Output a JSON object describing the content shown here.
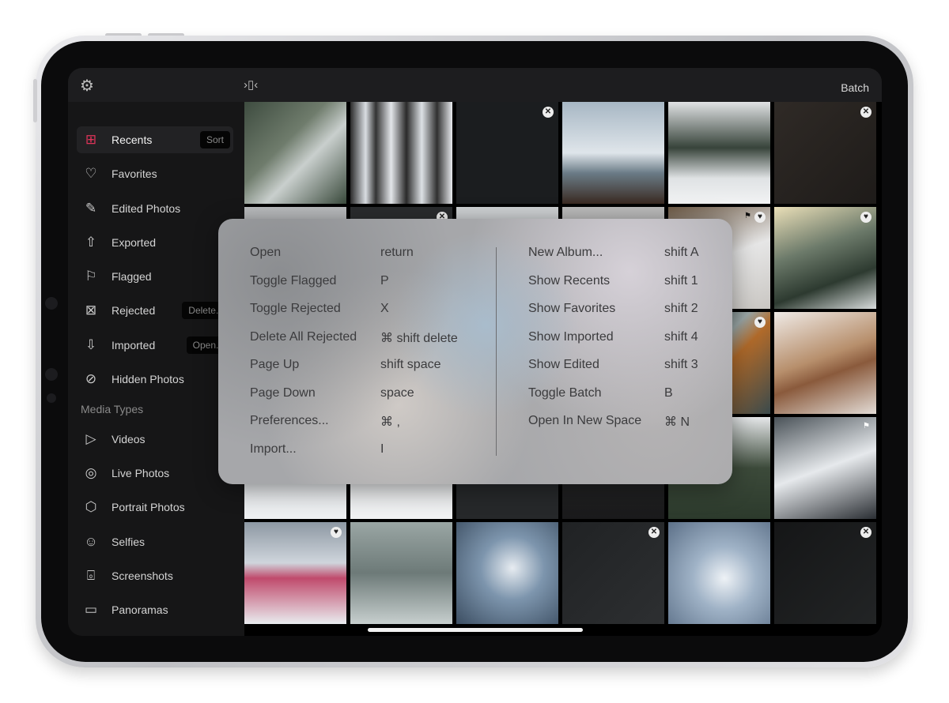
{
  "topbar": {
    "batch_label": "Batch",
    "settings_icon": "gear-icon",
    "vibrate_icon": "phone-vibrate-icon"
  },
  "accent_color": "#e0345a",
  "sidebar": {
    "items": [
      {
        "label": "Recents",
        "icon": "grid-icon",
        "glyph": "⊞",
        "active": true,
        "pill": "Sort"
      },
      {
        "label": "Favorites",
        "icon": "heart-icon",
        "glyph": "♡"
      },
      {
        "label": "Edited Photos",
        "icon": "pencil-icon",
        "glyph": "✎"
      },
      {
        "label": "Exported",
        "icon": "share-icon",
        "glyph": "⇧"
      },
      {
        "label": "Flagged",
        "icon": "flag-icon",
        "glyph": "⚐"
      },
      {
        "label": "Rejected",
        "icon": "reject-icon",
        "glyph": "⊠",
        "pill": "Delete..."
      },
      {
        "label": "Imported",
        "icon": "download-icon",
        "glyph": "⇩",
        "pill": "Open..."
      },
      {
        "label": "Hidden Photos",
        "icon": "eye-slash-icon",
        "glyph": "⊘"
      }
    ],
    "media_header": "Media Types",
    "media_items": [
      {
        "label": "Videos",
        "icon": "play-circle-icon",
        "glyph": "▷"
      },
      {
        "label": "Live Photos",
        "icon": "live-photo-icon",
        "glyph": "◎"
      },
      {
        "label": "Portrait Photos",
        "icon": "cube-icon",
        "glyph": "⬡"
      },
      {
        "label": "Selfies",
        "icon": "selfie-icon",
        "glyph": "☺"
      },
      {
        "label": "Screenshots",
        "icon": "screenshot-icon",
        "glyph": "⌻"
      },
      {
        "label": "Panoramas",
        "icon": "panorama-icon",
        "glyph": "▭"
      }
    ]
  },
  "photos": [
    {
      "bg": "linear-gradient(135deg,#3e4c40,#6f7c6c 40%,#c9cfcd 60%,#3a4a3c)"
    },
    {
      "bg": "linear-gradient(90deg,#2b2b2b 0,#d9dde2 15%,#333 25%,#e3e6ea 40%,#2a2a2a 55%,#dde1e5 70%,#303030 85%,#e8eaee)"
    },
    {
      "bg": "#1b1d1f",
      "badge": "reject"
    },
    {
      "bg": "linear-gradient(180deg,#a7b7c4,#dfe5ea 50%,#6a7b86 70%,#3a2a22)"
    },
    {
      "bg": "linear-gradient(180deg,#e0e2e4,#37433a 45%,#dfe2e4 75%,#f2f3f4)"
    },
    {
      "bg": "linear-gradient(135deg,#2f2a26,#1e1b19)",
      "badge": "reject"
    },
    {
      "bg": "linear-gradient(180deg,#b9bbbd,#8c8e8f)"
    },
    {
      "bg": "#2a2c2e",
      "badge": "reject"
    },
    {
      "bg": "linear-gradient(180deg,#cfd2d4,#9fa2a4)"
    },
    {
      "bg": "linear-gradient(180deg,#bcbcbc,#8a8a8a)"
    },
    {
      "bg": "linear-gradient(160deg,#6d5a46,#e6e6e6 50%,#c9c6c2)",
      "badge": "heart",
      "flag": true
    },
    {
      "bg": "linear-gradient(160deg,#eadfb8,#6c7a6a 40%,#2d3a30 70%,#d8dcdc)",
      "badge": "heart"
    },
    {
      "bg": "#555"
    },
    {
      "bg": "#666"
    },
    {
      "bg": "#555"
    },
    {
      "bg": "#666"
    },
    {
      "bg": "linear-gradient(135deg,#2f3c3e,#9aa6a6 40%,#b06a2a 55%,#3a4a4c)",
      "badge": "heart"
    },
    {
      "bg": "linear-gradient(160deg,#efeae6,#b78f6c 45%,#8a5a3c 60%,#e3dcd6)"
    },
    {
      "bg": "linear-gradient(180deg,#c8cbce,#eef0f2)"
    },
    {
      "bg": "linear-gradient(180deg,#c9ccce,#f1f2f3)"
    },
    {
      "bg": "#26282a"
    },
    {
      "bg": "linear-gradient(180deg,#2c2d2f,#1a1a1b)"
    },
    {
      "bg": "linear-gradient(180deg,#e5e7e9,#3c4a3a 50%,#2c3a2c)"
    },
    {
      "bg": "linear-gradient(160deg,#4a5258,#e6e9ec 50%,#2a2e33)",
      "flag": true
    },
    {
      "bg": "linear-gradient(180deg,#8d98a3,#cfd5dc 40%,#c04a6c 55%,#e9ecef)",
      "badge": "heart"
    },
    {
      "bg": "linear-gradient(180deg,#9aa6a4,#6d7a78 50%,#c7cfce)"
    },
    {
      "bg": "radial-gradient(circle at 55% 45%,#e7ecf1 0,#7d95ad 40%,#3c4e62)"
    },
    {
      "bg": "linear-gradient(135deg,#202224,#2d2f31)",
      "badge": "reject"
    },
    {
      "bg": "radial-gradient(circle at 55% 55%,#eef2f6 0,#9fb2c6 40%,#5c7088)"
    },
    {
      "bg": "linear-gradient(135deg,#151617,#222425)",
      "badge": "reject"
    }
  ],
  "shortcuts": {
    "left": [
      {
        "action": "Open",
        "keys": "return"
      },
      {
        "action": "Toggle Flagged",
        "keys": "P"
      },
      {
        "action": "Toggle Rejected",
        "keys": "X"
      },
      {
        "action": "Delete All Rejected",
        "keys": "⌘  shift delete"
      },
      {
        "action": "Page Up",
        "keys": "shift space"
      },
      {
        "action": "Page Down",
        "keys": "space"
      },
      {
        "action": "Preferences...",
        "keys": "⌘  ,"
      },
      {
        "action": "Import...",
        "keys": "I"
      }
    ],
    "right": [
      {
        "action": "New Album...",
        "keys": "shift A"
      },
      {
        "action": "Show Recents",
        "keys": "shift 1"
      },
      {
        "action": "Show Favorites",
        "keys": "shift 2"
      },
      {
        "action": "Show Imported",
        "keys": "shift 4"
      },
      {
        "action": "Show Edited",
        "keys": "shift 3"
      },
      {
        "action": "Toggle Batch",
        "keys": "B"
      },
      {
        "action": "Open In New Space",
        "keys": "⌘  N"
      }
    ]
  }
}
